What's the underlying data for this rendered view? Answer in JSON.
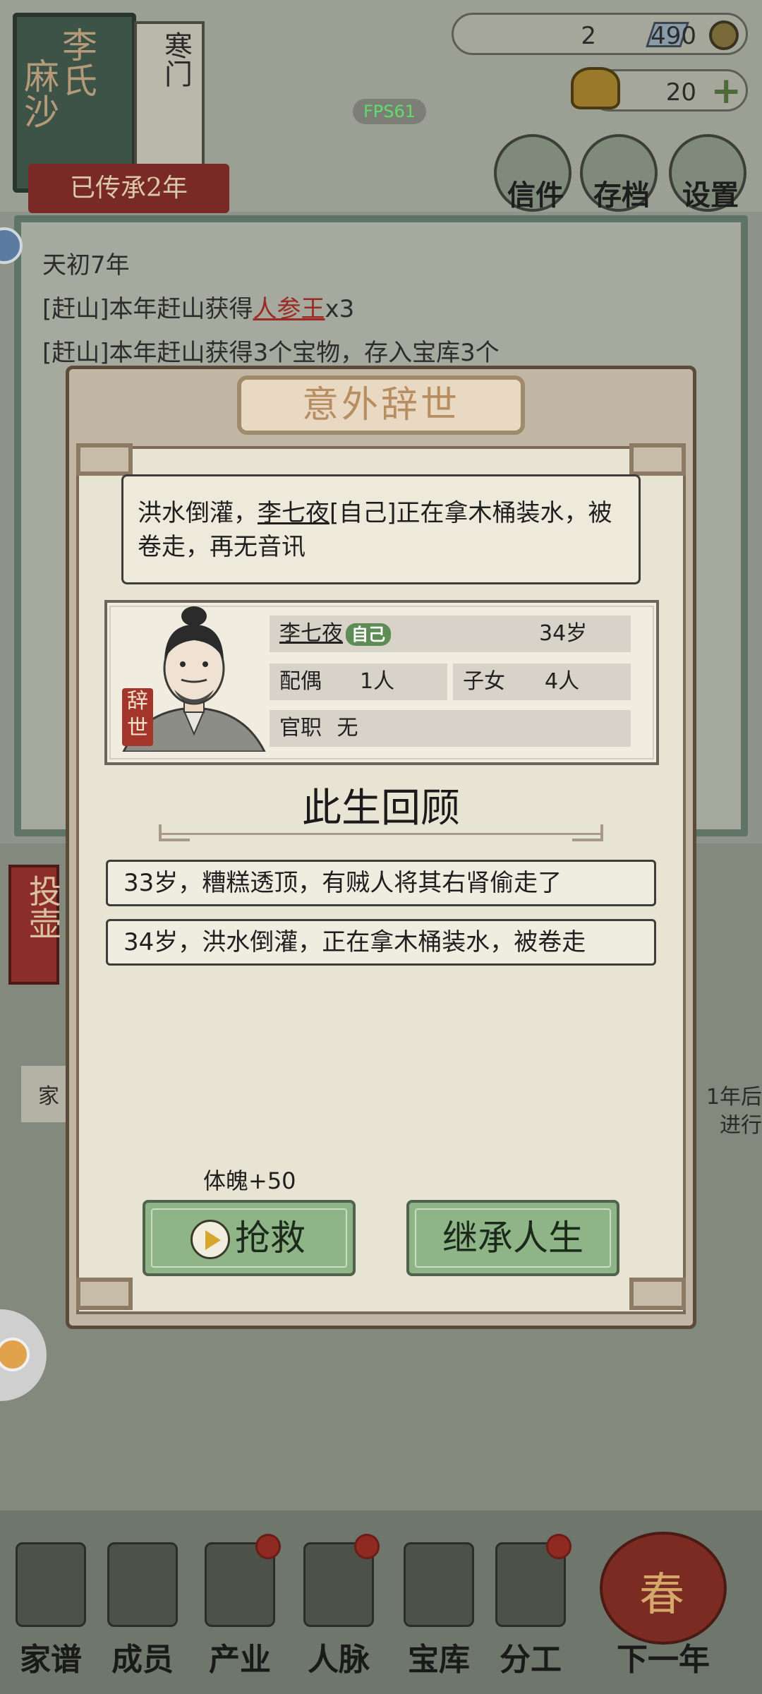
{
  "header": {
    "spouse_name": "麻沙",
    "clan_name": "李氏",
    "clan_rank": "寒门",
    "heritage_label": "已传承2年",
    "fps": "FPS61",
    "silver_count": "2",
    "coin_count": "490",
    "gold_count": "20"
  },
  "top_buttons": [
    {
      "label": "信件"
    },
    {
      "label": "存档"
    },
    {
      "label": "设置"
    }
  ],
  "log": {
    "year": "天初7年",
    "line1_prefix": "[赶山]本年赶山获得",
    "line1_item": "人参王",
    "line1_suffix": "x3",
    "line2": "[赶山]本年赶山获得3个宝物，存入宝库3个"
  },
  "side": {
    "tag_label": "投壶",
    "left_fragment": "家",
    "right_fragment_1": "1年后",
    "right_fragment_2": "进行"
  },
  "dialog": {
    "title": "意外辞世",
    "message_prefix": "洪水倒灌，",
    "message_name": "李七夜",
    "message_suffix": "[自己]正在拿木桶装水，被卷走，再无音讯",
    "portrait_seal": "辞世",
    "char_name": "李七夜",
    "self_badge": "自己",
    "age": "34岁",
    "spouse_label": "配偶",
    "spouse_value": "1人",
    "children_label": "子女",
    "children_value": "4人",
    "office_label": "官职",
    "office_value": "无",
    "review_title": "此生回顾",
    "review_items": [
      "33岁，糟糕透顶，有贼人将其右肾偷走了",
      "34岁，洪水倒灌，正在拿木桶装水，被卷走"
    ],
    "bonus_text": "体魄+50",
    "rescue_label": "抢救",
    "inherit_label": "继承人生"
  },
  "bottom_nav": [
    {
      "label": "家谱"
    },
    {
      "label": "成员"
    },
    {
      "label": "产业"
    },
    {
      "label": "人脉"
    },
    {
      "label": "宝库"
    },
    {
      "label": "分工"
    },
    {
      "label": "下一年"
    }
  ],
  "lantern_char": "春",
  "colors": {
    "modal_border": "#5c4a3a",
    "button_green": "#8eb487",
    "title_gold": "#b78e62",
    "seal_red": "#a4352a",
    "fps_green": "#5fdc6a"
  }
}
